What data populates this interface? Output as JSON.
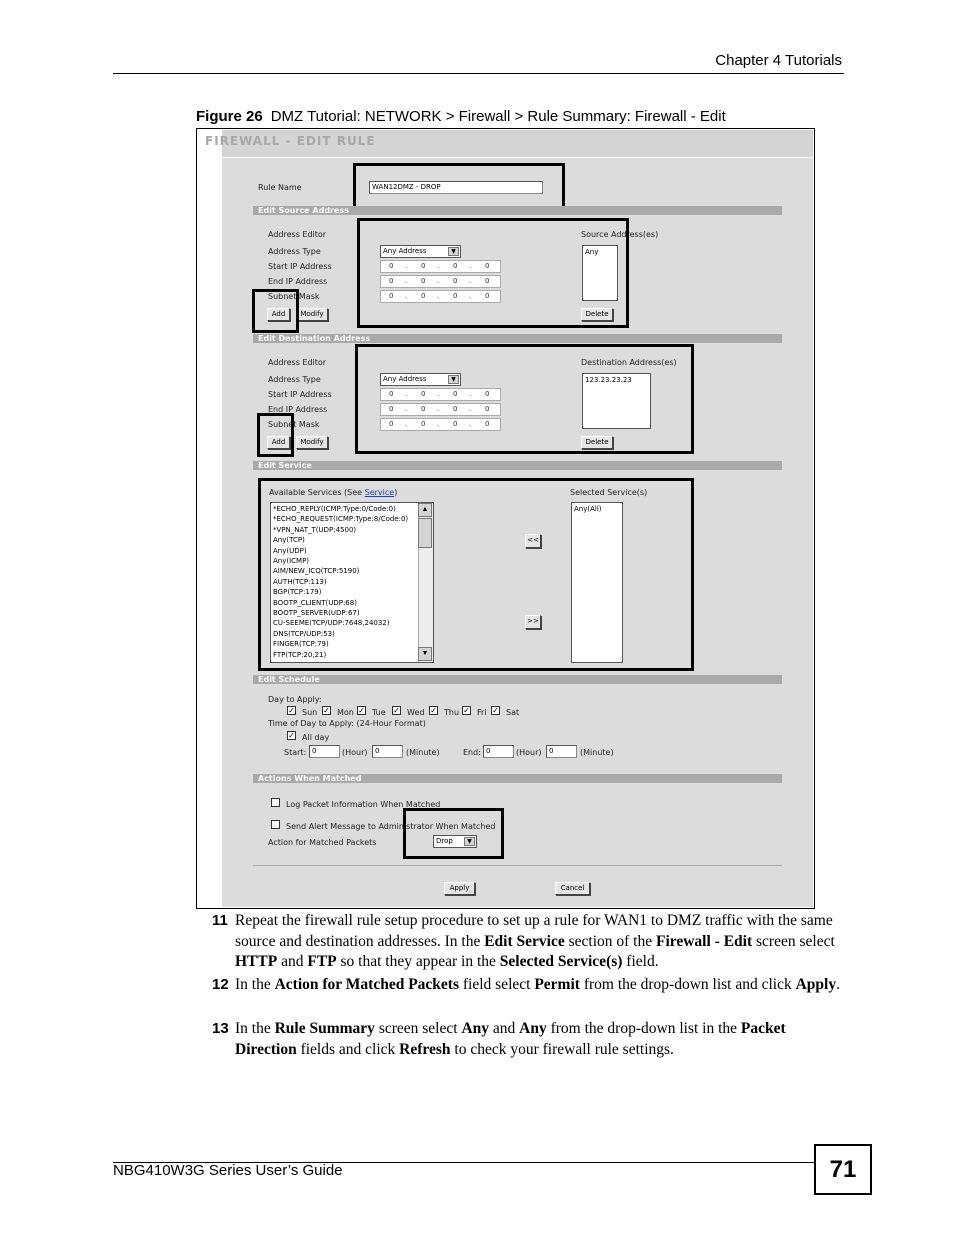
{
  "header": {
    "chapter": "Chapter 4 Tutorials"
  },
  "figure": {
    "number": "Figure 26",
    "caption": "DMZ Tutorial: NETWORK > Firewall > Rule Summary: Firewall - Edit"
  },
  "screen": {
    "title": "FIREWALL - EDIT RULE",
    "rule_name_label": "Rule Name",
    "rule_name_value": "WAN12DMZ - DROP",
    "source": {
      "section": "Edit Source Address",
      "address_editor": "Address Editor",
      "address_type_label": "Address Type",
      "address_type_value": "Any Address",
      "start_ip_label": "Start IP Address",
      "end_ip_label": "End IP Address",
      "subnet_mask_label": "Subnet Mask",
      "add": "Add",
      "modify": "Modify",
      "list_label": "Source Address(es)",
      "list_items": [
        "Any"
      ],
      "delete": "Delete"
    },
    "destination": {
      "section": "Edit Destination Address",
      "address_editor": "Address Editor",
      "address_type_label": "Address Type",
      "address_type_value": "Any Address",
      "start_ip_label": "Start IP Address",
      "end_ip_label": "End IP Address",
      "subnet_mask_label": "Subnet Mask",
      "add": "Add",
      "modify": "Modify",
      "list_label": "Destination Address(es)",
      "list_items": [
        "123.23.23.23"
      ],
      "delete": "Delete"
    },
    "ip_octet": "0",
    "ip_dot": ".",
    "service": {
      "section": "Edit Service",
      "available_label": "Available Services  (See ",
      "available_link": "Service",
      "available_close": ")",
      "available": [
        "*ECHO_REPLY(ICMP:Type:0/Code:0)",
        "*ECHO_REQUEST(ICMP:Type:8/Code:0)",
        "*VPN_NAT_T(UDP:4500)",
        "Any(TCP)",
        "Any(UDP)",
        "Any(ICMP)",
        "AIM/NEW_ICQ(TCP:5190)",
        "AUTH(TCP:113)",
        "BGP(TCP:179)",
        "BOOTP_CLIENT(UDP:68)",
        "BOOTP_SERVER(UDP:67)",
        "CU-SEEME(TCP/UDP:7648,24032)",
        "DNS(TCP/UDP:53)",
        "FINGER(TCP:79)",
        "FTP(TCP:20,21)"
      ],
      "remove_btn": "<<",
      "add_btn": ">>",
      "selected_label": "Selected Service(s)",
      "selected": [
        "Any(All)"
      ],
      "scroll_up": "▲",
      "scroll_down": "▼"
    },
    "schedule": {
      "section": "Edit Schedule",
      "day_label": "Day to Apply:",
      "days": [
        "Sun",
        "Mon",
        "Tue",
        "Wed",
        "Thu",
        "Fri",
        "Sat"
      ],
      "check": "✓",
      "time_label": "Time of Day to Apply: (24-Hour Format)",
      "all_day": "All day",
      "start_label": "Start:",
      "end_label": "End:",
      "hour": "(Hour)",
      "minute": "(Minute)",
      "start_hour": "0",
      "start_minute": "0",
      "end_hour": "0",
      "end_minute": "0"
    },
    "actions": {
      "section": "Actions When Matched",
      "log_label": "Log Packet Information When Matched",
      "alert_label": "Send Alert Message to Administrator When Matched",
      "action_label": "Action for Matched Packets",
      "action_value": "Drop"
    },
    "apply": "Apply",
    "cancel": "Cancel",
    "dropdown_arrow": "▼"
  },
  "steps": [
    {
      "num": "11",
      "parts": [
        {
          "t": "Repeat the firewall rule setup procedure to set up a rule for WAN1 to DMZ traffic with the same source and destination addresses. In the "
        },
        {
          "t": "Edit Service",
          "b": true
        },
        {
          "t": " section of the "
        },
        {
          "t": "Firewall - Edit",
          "b": true
        },
        {
          "t": " screen select "
        },
        {
          "t": "HTTP",
          "b": true
        },
        {
          "t": " and "
        },
        {
          "t": "FTP",
          "b": true
        },
        {
          "t": " so that they appear in the "
        },
        {
          "t": "Selected Service(s)",
          "b": true
        },
        {
          "t": " field."
        }
      ]
    },
    {
      "num": "12",
      "parts": [
        {
          "t": "In the "
        },
        {
          "t": "Action for Matched Packets",
          "b": true
        },
        {
          "t": " field select "
        },
        {
          "t": "Permit",
          "b": true
        },
        {
          "t": " from the drop-down list and click "
        },
        {
          "t": "Apply",
          "b": true
        },
        {
          "t": "."
        }
      ]
    },
    {
      "num": "13",
      "parts": [
        {
          "t": "In the "
        },
        {
          "t": "Rule Summary",
          "b": true
        },
        {
          "t": " screen select "
        },
        {
          "t": "Any",
          "b": true
        },
        {
          "t": " and "
        },
        {
          "t": "Any",
          "b": true
        },
        {
          "t": " from the drop-down list in the "
        },
        {
          "t": "Packet Direction",
          "b": true
        },
        {
          "t": " fields and click "
        },
        {
          "t": "Refresh",
          "b": true
        },
        {
          "t": " to check your firewall rule settings."
        }
      ]
    }
  ],
  "footer": {
    "guide_title": "NBG410W3G Series User’s Guide",
    "page_number": "71"
  }
}
